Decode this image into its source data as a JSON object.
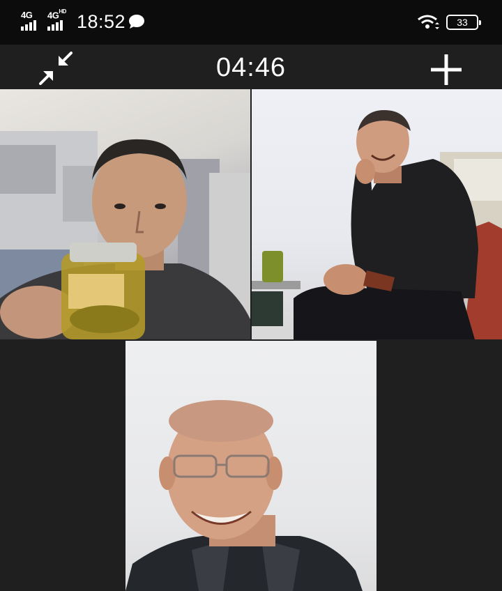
{
  "status_bar": {
    "network_1": "4G",
    "network_2": "4G",
    "network_2_suffix": "HD",
    "time": "18:52",
    "battery": "33",
    "icons": [
      "signal-icon",
      "chat-bubble-icon",
      "wifi-icon",
      "battery-icon"
    ]
  },
  "call": {
    "timer": "04:46",
    "minimize_icon": "minimize-arrows-icon",
    "add_icon": "plus-icon",
    "participants": [
      {
        "tile": "top-left"
      },
      {
        "tile": "top-right"
      },
      {
        "tile": "bottom-center"
      }
    ]
  },
  "colors": {
    "background": "#1f1f1f",
    "status_bar": "#0c0c0c",
    "text": "#ffffff"
  }
}
